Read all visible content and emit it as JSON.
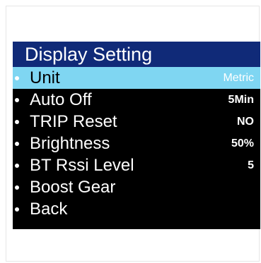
{
  "screen": {
    "title": "Display Setting",
    "colors": {
      "title_bar": "#102a78",
      "background": "#000000",
      "highlight": "#7fd6f2",
      "text": "#ffffff"
    },
    "selected_index": 0,
    "items": [
      {
        "label": "Unit",
        "value": "Metric"
      },
      {
        "label": "Auto Off",
        "value": "5Min"
      },
      {
        "label": "TRIP Reset",
        "value": "NO"
      },
      {
        "label": "Brightness",
        "value": "50%"
      },
      {
        "label": "BT Rssi Level",
        "value": "5"
      },
      {
        "label": "Boost Gear",
        "value": ""
      },
      {
        "label": "Back",
        "value": ""
      }
    ]
  }
}
